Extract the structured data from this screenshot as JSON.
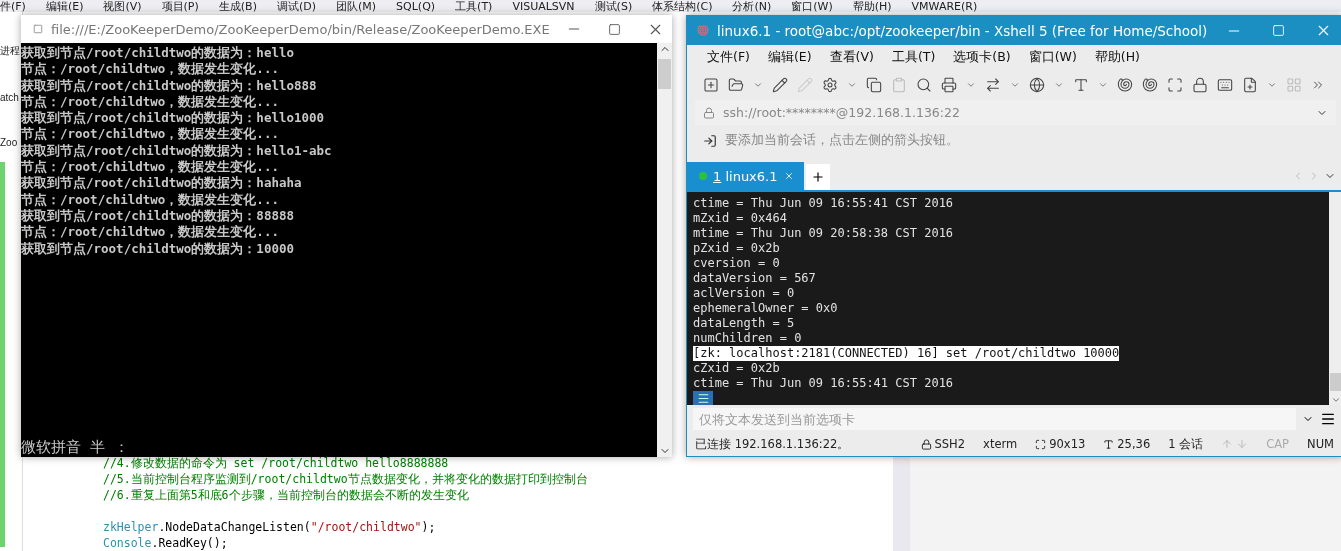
{
  "ide": {
    "menu": [
      "件(F)",
      "编辑(E)",
      "视图(V)",
      "项目(P)",
      "生成(B)",
      "调试(D)",
      "团队(M)",
      "SQL(Q)",
      "工具(T)",
      "VISUALSVN",
      "测试(S)",
      "体系结构(C)",
      "分析(N)",
      "窗口(W)",
      "帮助(H)",
      "VMWARE(R)"
    ],
    "gutter_fragments": [
      "进程",
      "atch",
      "Zoo"
    ],
    "code_lines": [
      {
        "kind": "comment",
        "text": "//4.修改数据的命令为 set /root/childtwo hello8888888"
      },
      {
        "kind": "comment",
        "text": "//5.当前控制台程序监测到/root/childtwo节点数据变化，并将变化的数据打印到控制台"
      },
      {
        "kind": "comment",
        "text": "//6.重复上面第5和底6个步骤，当前控制台的数据会不断的发生变化"
      },
      {
        "kind": "blank"
      },
      {
        "kind": "code",
        "parts": [
          {
            "kind": "type",
            "text": "zkHelper"
          },
          {
            "kind": "plain",
            "text": ".NodeDataChangeListen("
          },
          {
            "kind": "string",
            "text": "\"/root/childtwo\""
          },
          {
            "kind": "plain",
            "text": ");"
          }
        ]
      },
      {
        "kind": "code",
        "parts": [
          {
            "kind": "type",
            "text": "Console"
          },
          {
            "kind": "plain",
            "text": ".ReadKey();"
          }
        ]
      }
    ]
  },
  "console": {
    "title": "file:///E:/ZooKeeperDemo/ZooKeeperDemo/bin/Release/ZooKeeperDemo.EXE",
    "lines": [
      "获取到节点/root/childtwo的数据为：hello",
      "节点：/root/childtwo，数据发生变化...",
      "获取到节点/root/childtwo的数据为：hello888",
      "节点：/root/childtwo，数据发生变化...",
      "获取到节点/root/childtwo的数据为：hello1000",
      "节点：/root/childtwo，数据发生变化...",
      "获取到节点/root/childtwo的数据为：hello1-abc",
      "节点：/root/childtwo，数据发生变化...",
      "获取到节点/root/childtwo的数据为：hahaha",
      "节点：/root/childtwo，数据发生变化...",
      "获取到节点/root/childtwo的数据为：88888",
      "节点：/root/childtwo，数据发生变化...",
      "获取到节点/root/childtwo的数据为：10000"
    ],
    "ime_status": "微软拼音 半 ："
  },
  "xshell": {
    "title": "linux6.1 - root@abc:/opt/zookeeper/bin - Xshell 5 (Free for Home/School)",
    "menu": [
      "文件(F)",
      "编辑(E)",
      "查看(V)",
      "工具(T)",
      "选项卡(B)",
      "窗口(W)",
      "帮助(H)"
    ],
    "address": "ssh://root:********@192.168.1.136:22",
    "hint": "要添加当前会话，点击左侧的箭头按钮。",
    "tabs": [
      {
        "number": "1",
        "label": "linux6.1",
        "selected": true,
        "connected": true
      }
    ],
    "terminal_lines": [
      {
        "text": "ctime = Thu Jun 09 16:55:41 CST 2016",
        "highlighted": false
      },
      {
        "text": "mZxid = 0x464",
        "highlighted": false
      },
      {
        "text": "mtime = Thu Jun 09 20:58:38 CST 2016",
        "highlighted": false
      },
      {
        "text": "pZxid = 0x2b",
        "highlighted": false
      },
      {
        "text": "cversion = 0",
        "highlighted": false
      },
      {
        "text": "dataVersion = 567",
        "highlighted": false
      },
      {
        "text": "aclVersion = 0",
        "highlighted": false
      },
      {
        "text": "ephemeralOwner = 0x0",
        "highlighted": false
      },
      {
        "text": "dataLength = 5",
        "highlighted": false
      },
      {
        "text": "numChildren = 0",
        "highlighted": false
      },
      {
        "text": "[zk: localhost:2181(CONNECTED) 16] set /root/childtwo 10000",
        "highlighted": true
      },
      {
        "text": "cZxid = 0x2b",
        "highlighted": false
      },
      {
        "text": "ctime = Thu Jun 09 16:55:41 CST 2016",
        "highlighted": false
      }
    ],
    "send_placeholder": "仅将文本发送到当前选项卡",
    "status": {
      "connection": "已连接 192.168.1.136:22。",
      "protocol": "SSH2",
      "terminal_type": "xterm",
      "size": "90x13",
      "cursor": "25,36",
      "sessions": "1 会话",
      "locks": [
        {
          "label": "CAP",
          "on": false
        },
        {
          "label": "NUM",
          "on": true
        }
      ]
    }
  }
}
